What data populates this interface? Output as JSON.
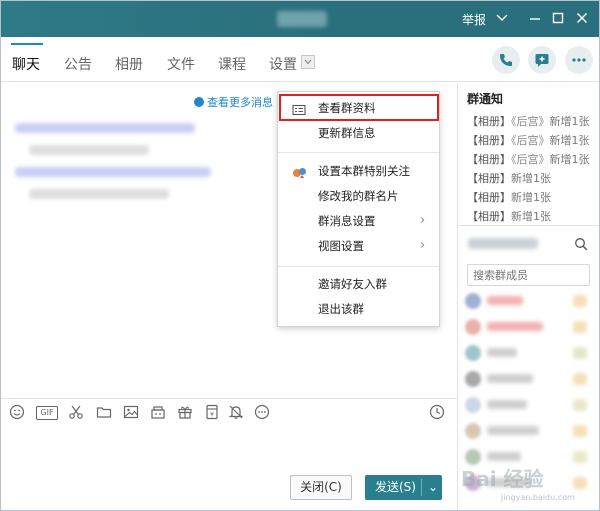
{
  "window": {
    "report_label": "举报",
    "colors": {
      "titlebar": "#2a6f7c",
      "accent": "#1e88c9",
      "send_button": "#2a7f8e",
      "highlight": "#e02020"
    }
  },
  "tabs": [
    {
      "label": "聊天",
      "active": true
    },
    {
      "label": "公告",
      "active": false
    },
    {
      "label": "相册",
      "active": false
    },
    {
      "label": "文件",
      "active": false
    },
    {
      "label": "课程",
      "active": false
    },
    {
      "label": "设置",
      "active": false
    }
  ],
  "chat": {
    "more_messages": "查看更多消息"
  },
  "context_menu": {
    "items": [
      {
        "label": "查看群资料",
        "icon": "card-icon",
        "highlighted": true
      },
      {
        "label": "更新群信息"
      },
      {
        "label": "设置本群特别关注",
        "icon": "special-follow-icon"
      },
      {
        "label": "修改我的群名片"
      },
      {
        "label": "群消息设置",
        "submenu": true
      },
      {
        "label": "视图设置",
        "submenu": true
      },
      {
        "label": "邀请好友入群"
      },
      {
        "label": "退出该群"
      }
    ],
    "submenu_glyph": "›"
  },
  "toolbar": {
    "gif_label": "GIF",
    "icons": [
      "emoji-icon",
      "gif-icon",
      "scissors-icon",
      "folder-icon",
      "image-icon",
      "gift-box-icon",
      "gift-icon",
      "red-packet-icon",
      "bell-icon",
      "more-dots-icon",
      "history-icon"
    ]
  },
  "footer": {
    "close_label": "关闭(C)",
    "send_label": "发送(S)",
    "send_arrow": "⌄"
  },
  "notice": {
    "title": "群通知",
    "items": [
      {
        "tag": "【相册】",
        "album": "《后宫》",
        "text": "新增1张"
      },
      {
        "tag": "【相册】",
        "album": "《后宫》",
        "text": "新增1张"
      },
      {
        "tag": "【相册】",
        "album": "《后宫》",
        "text": "新增1张"
      },
      {
        "tag": "【相册】",
        "album": "",
        "text": "新增1张"
      },
      {
        "tag": "【相册】",
        "album": "",
        "text": "新增1张"
      },
      {
        "tag": "【相册】",
        "album": "",
        "text": "新增1张"
      }
    ]
  },
  "members": {
    "search_placeholder": "搜索群成员"
  },
  "watermark": {
    "text": "Bai 经验",
    "sub": "jingyan.baidu.com"
  }
}
